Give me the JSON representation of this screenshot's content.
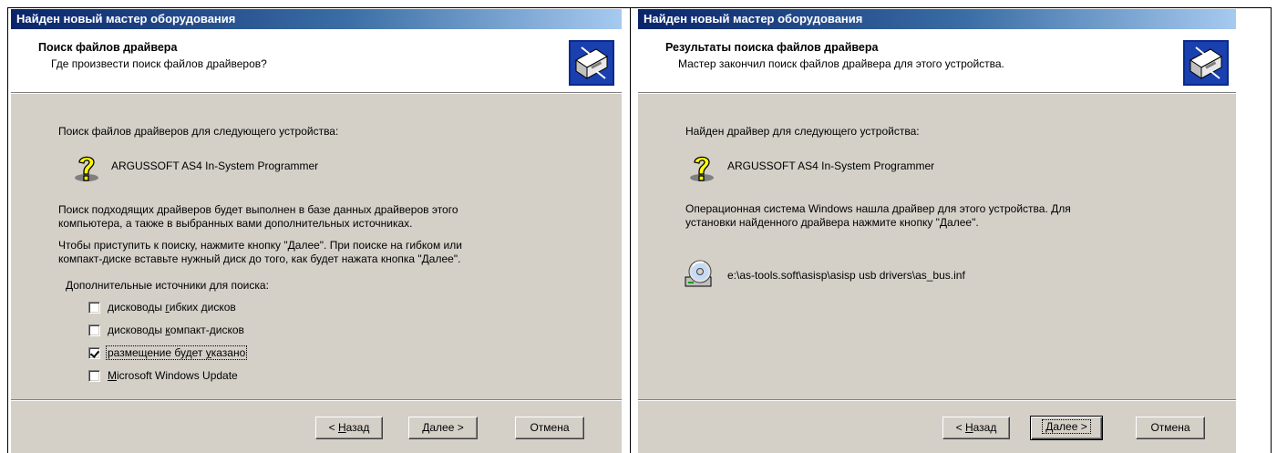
{
  "left_wizard": {
    "title": "Найден новый мастер оборудования",
    "header_title": "Поиск файлов драйвера",
    "header_subtitle": "Где произвести поиск файлов драйверов?",
    "intro": "Поиск файлов драйверов для следующего устройства:",
    "device_name": "ARGUSSOFT AS4 In-System Programmer",
    "para1_line1": "Поиск подходящих драйверов будет выполнен в базе данных драйверов этого",
    "para1_line2": "компьютера, а также в выбранных вами дополнительных источниках.",
    "para2_line1": "Чтобы приступить к поиску, нажмите кнопку \"Далее\". При поиске на гибком или",
    "para2_line2": "компакт-диске вставьте нужный диск до того, как будет нажата кнопка \"Далее\".",
    "sources_label": "Дополнительные источники для поиска:",
    "options": [
      {
        "pre": "дисководы ",
        "key": "г",
        "post": "ибких дисков",
        "checked": false
      },
      {
        "pre": "дисководы ",
        "key": "к",
        "post": "омпакт-дисков",
        "checked": false
      },
      {
        "pre": "размещение будет ",
        "key": "у",
        "post": "казано",
        "checked": true
      },
      {
        "pre": "",
        "key": "M",
        "post": "icrosoft Windows Update",
        "checked": false
      }
    ],
    "back_pre": "< ",
    "back_key": "Н",
    "back_post": "азад",
    "next_label": "Далее >",
    "cancel_label": "Отмена"
  },
  "right_wizard": {
    "title": "Найден новый мастер оборудования",
    "header_title": "Результаты поиска файлов драйвера",
    "header_subtitle": "Мастер закончил поиск файлов драйвера для этого устройства.",
    "intro": "Найден драйвер для следующего устройства:",
    "device_name": "ARGUSSOFT AS4 In-System Programmer",
    "para1_line1": "Операционная система Windows нашла драйвер для этого устройства. Для",
    "para1_line2": "установки найденного драйвера нажмите кнопку \"Далее\".",
    "driver_path": "e:\\as-tools.soft\\asisp\\asisp usb drivers\\as_bus.inf",
    "back_pre": "< ",
    "back_key": "Н",
    "back_post": "азад",
    "next_label": "Далее >",
    "cancel_label": "Отмена"
  },
  "icons": {
    "hardware": "hardware-wizard-icon",
    "unknown_device": "question-mark-icon",
    "driver_file": "cd-driver-icon"
  },
  "colors": {
    "titlebar_start": "#0a246a",
    "titlebar_end": "#a6caf0",
    "dialog_face": "#d4d0c8"
  }
}
